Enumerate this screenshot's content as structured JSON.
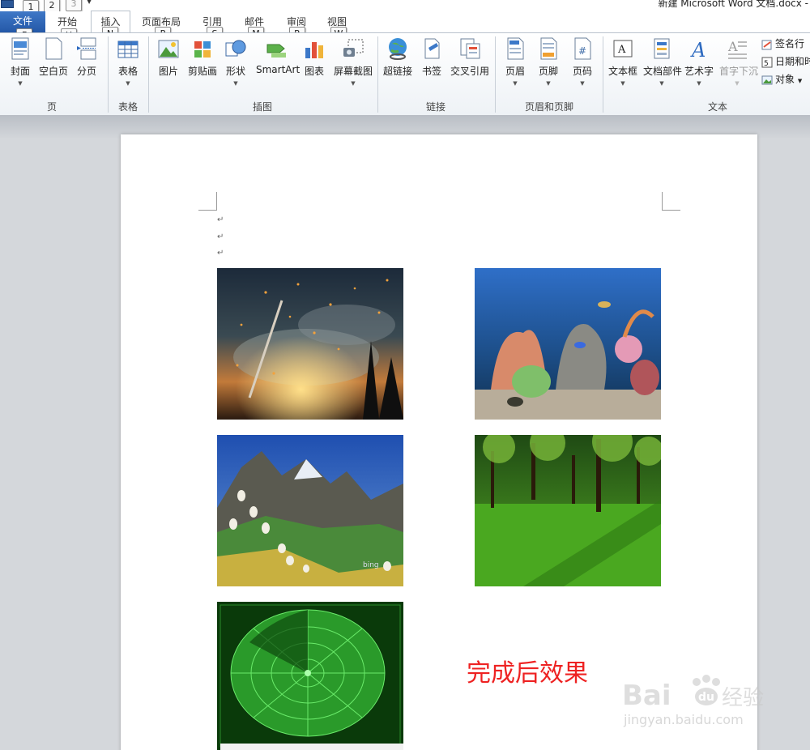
{
  "window": {
    "title": "新建 Microsoft Word 文档.docx -"
  },
  "qat": {
    "keytips": [
      "1",
      "2",
      "3"
    ]
  },
  "tabs": {
    "file": "文件",
    "items": [
      "开始",
      "插入",
      "页面布局",
      "引用",
      "邮件",
      "审阅",
      "视图"
    ],
    "keytips": [
      "F",
      "H",
      "N",
      "P",
      "S",
      "M",
      "R",
      "W"
    ]
  },
  "ribbon": {
    "groups": {
      "page": {
        "label": "页",
        "buttons": [
          "封面",
          "空白页",
          "分页"
        ]
      },
      "table": {
        "label": "表格",
        "buttons": [
          "表格"
        ]
      },
      "illustrations": {
        "label": "插图",
        "buttons": [
          "图片",
          "剪贴画",
          "形状",
          "SmartArt",
          "图表",
          "屏幕截图"
        ]
      },
      "links": {
        "label": "链接",
        "buttons": [
          "超链接",
          "书签",
          "交叉引用"
        ]
      },
      "header_footer": {
        "label": "页眉和页脚",
        "buttons": [
          "页眉",
          "页脚",
          "页码"
        ]
      },
      "text": {
        "label": "文本",
        "buttons": [
          "文本框",
          "文档部件",
          "艺术字",
          "首字下沉"
        ],
        "small_buttons": [
          "签名行",
          "日期和时",
          "对象"
        ]
      }
    }
  },
  "document": {
    "paragraph_mark": "↵",
    "caption": "完成后效果",
    "images": [
      "fantasy-night-sky",
      "aquarium-coral",
      "mountain-flowers",
      "green-forest-lawn",
      "green-radar"
    ]
  },
  "watermark": {
    "brand": "Bai",
    "brand_suffix": "经验",
    "url": "jingyan.baidu.com"
  }
}
